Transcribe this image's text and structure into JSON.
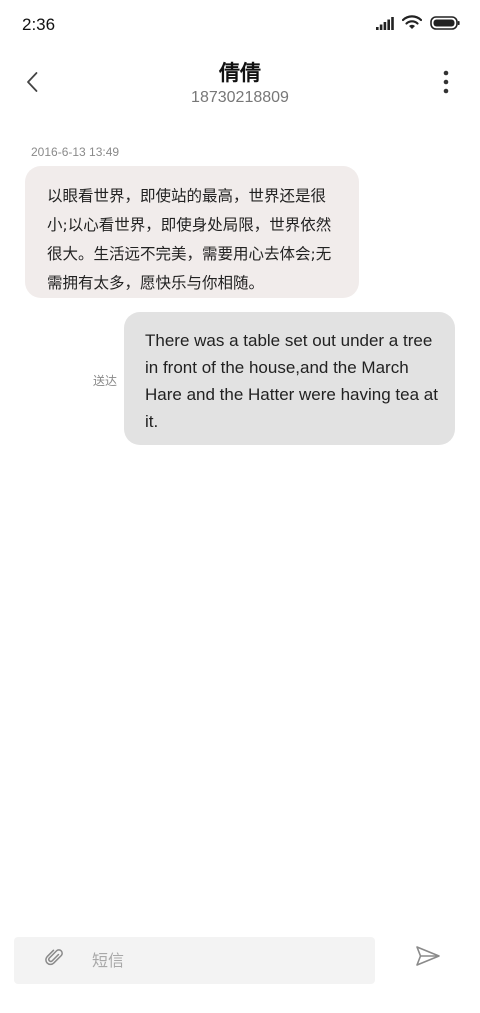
{
  "status_bar": {
    "time": "2:36",
    "icons": [
      "signal-icon",
      "wifi-icon",
      "battery-icon"
    ]
  },
  "header": {
    "contact_name": "倩倩",
    "contact_number": "18730218809",
    "icons": [
      "chevron-left-icon",
      "more-vertical-icon"
    ]
  },
  "conversation": {
    "timestamp": "2016-6-13 13:49",
    "incoming_message": "以眼看世界，即使站的最高，世界还是很小;以心看世界，即使身处局限，世界依然很大。生活远不完美，需要用心去体会;无需拥有太多，愿快乐与你相随。",
    "outgoing_message": "There was a table set out under a tree in front of the house,and the March Hare and the Hatter were having tea at it.",
    "outgoing_status": "送达"
  },
  "composer": {
    "placeholder": "短信",
    "value": "",
    "icons": [
      "paperclip-icon",
      "send-icon"
    ]
  },
  "colors": {
    "incoming_bubble": "#f1eceb",
    "outgoing_bubble": "#e2e2e2",
    "composer_background": "#f3f3f3",
    "secondary_text": "#8a8a8a"
  }
}
